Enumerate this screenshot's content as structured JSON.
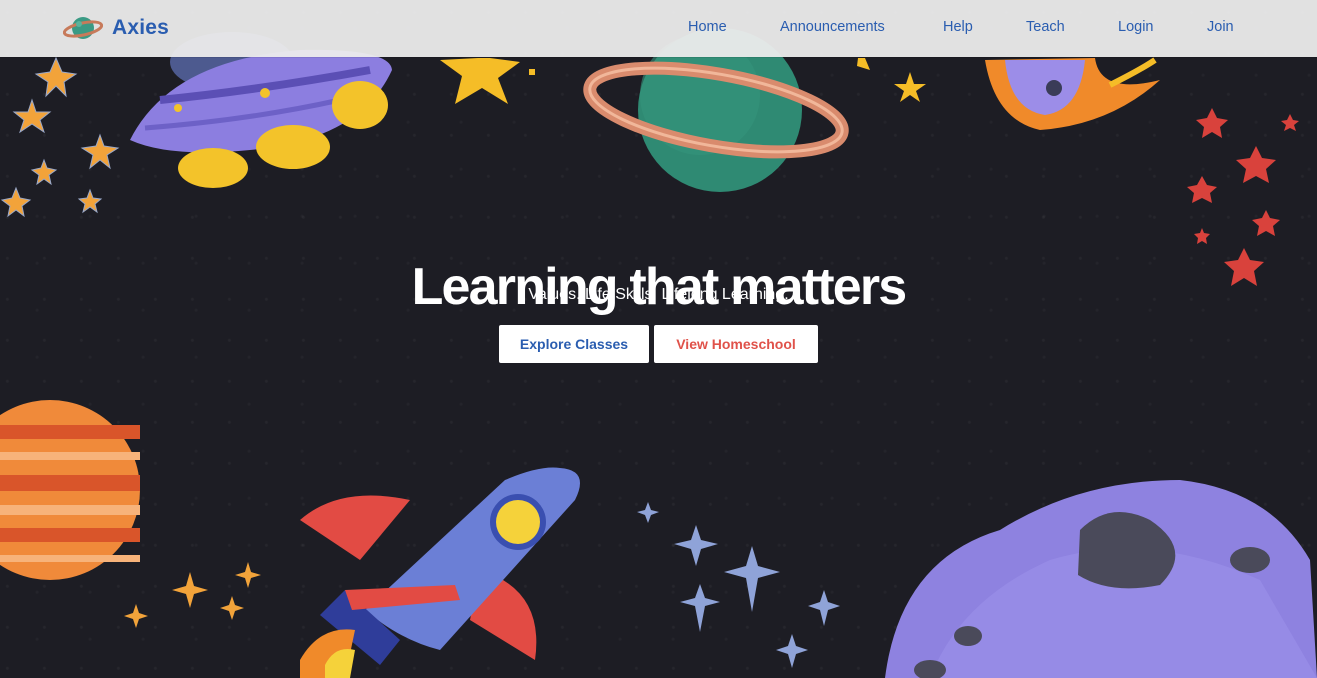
{
  "header": {
    "brand_name": "Axies",
    "logo_icon": "planet-logo-icon",
    "nav_links": [
      "Home",
      "Announcements",
      "Help",
      "Teach",
      "Login",
      "Join"
    ]
  },
  "hero": {
    "title": "Learning that matters",
    "subtitle": "Values. Life Skills. Lifelong Learning.",
    "primary_button": "Explore Classes",
    "secondary_button": "View Homeschool",
    "illustrations": [
      "ufo-icon",
      "ringed-planet-icon",
      "comet-icon",
      "striped-planet-icon",
      "rocket-icon",
      "asteroid-icon",
      "star-cluster-icon"
    ]
  },
  "colors": {
    "brand_blue": "#2a5db0",
    "accent_red": "#e0524a",
    "background": "#1d1d24",
    "nav_bg": "#ececec"
  }
}
